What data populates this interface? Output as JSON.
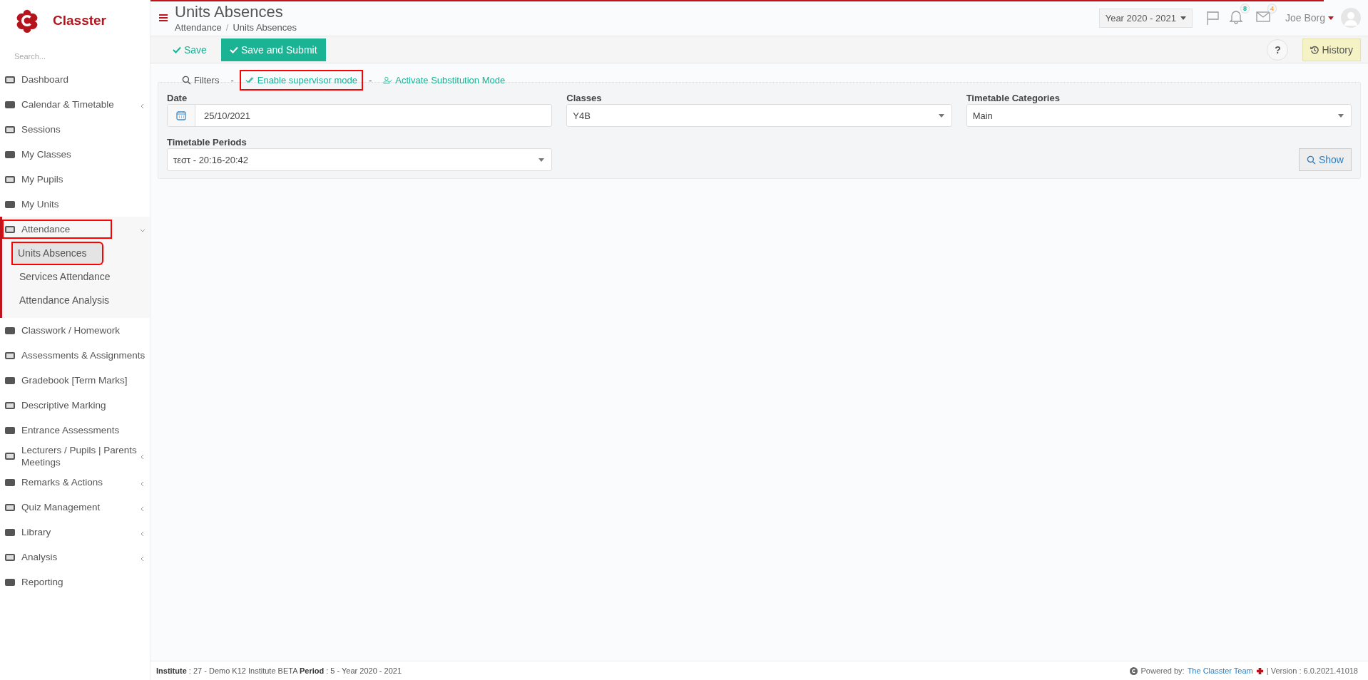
{
  "sidebar": {
    "logo": "Classter",
    "search": {
      "placeholder": "Search..."
    },
    "items": [
      {
        "label": "Dashboard",
        "submenu": false,
        "expanded": false,
        "highlighted": false
      },
      {
        "label": "Calendar & Timetable",
        "submenu": true,
        "expanded": false,
        "highlighted": false
      },
      {
        "label": "Sessions",
        "submenu": false,
        "expanded": false,
        "highlighted": false
      },
      {
        "label": "My Classes",
        "submenu": false,
        "expanded": false,
        "highlighted": false
      },
      {
        "label": "My Pupils",
        "submenu": false,
        "expanded": false,
        "highlighted": false
      },
      {
        "label": "My Units",
        "submenu": false,
        "expanded": false,
        "highlighted": false
      },
      {
        "label": "Attendance",
        "submenu": true,
        "expanded": true,
        "highlighted": true,
        "children": [
          {
            "label": "Units Absences",
            "selected": true,
            "highlighted": true
          },
          {
            "label": "Services Attendance",
            "selected": false,
            "highlighted": false
          },
          {
            "label": "Attendance Analysis",
            "selected": false,
            "highlighted": false
          }
        ]
      },
      {
        "label": "Classwork / Homework",
        "submenu": false,
        "expanded": false,
        "highlighted": false
      },
      {
        "label": "Assessments & Assignments",
        "submenu": true,
        "expanded": false,
        "highlighted": false
      },
      {
        "label": "Gradebook [Term Marks]",
        "submenu": false,
        "expanded": false,
        "highlighted": false
      },
      {
        "label": "Descriptive Marking",
        "submenu": false,
        "expanded": false,
        "highlighted": false
      },
      {
        "label": "Entrance Assessments",
        "submenu": false,
        "expanded": false,
        "highlighted": false
      },
      {
        "label": "Lecturers / Pupils | Parents Meetings",
        "submenu": true,
        "expanded": false,
        "highlighted": false
      },
      {
        "label": "Remarks & Actions",
        "submenu": true,
        "expanded": false,
        "highlighted": false
      },
      {
        "label": "Quiz Management",
        "submenu": true,
        "expanded": false,
        "highlighted": false
      },
      {
        "label": "Library",
        "submenu": true,
        "expanded": false,
        "highlighted": false
      },
      {
        "label": "Analysis",
        "submenu": true,
        "expanded": false,
        "highlighted": false
      },
      {
        "label": "Reporting",
        "submenu": false,
        "expanded": false,
        "highlighted": false
      }
    ]
  },
  "header": {
    "title": "Units Absences",
    "breadcrumb": [
      "Attendance",
      "Units Absences"
    ],
    "breadcrumb_separator": "/",
    "year": "Year 2020 - 2021",
    "notifications": [
      {
        "kind": "bell",
        "count": "8",
        "color": "#1ab394"
      },
      {
        "kind": "mail",
        "count": "4",
        "color": "#f8ac59"
      }
    ],
    "user": "Joe Borg"
  },
  "toolbar": {
    "save": "Save",
    "submit": "Save and Submit",
    "help": "?",
    "history": "History"
  },
  "filters": {
    "links": [
      {
        "kind": "filters",
        "label": "Filters",
        "highlighted": false
      },
      {
        "kind": "sep",
        "label": "-"
      },
      {
        "kind": "supervisor",
        "label": "Enable supervisor mode",
        "highlighted": true
      },
      {
        "kind": "sep",
        "label": "-"
      },
      {
        "kind": "substitution",
        "label": "Activate Substitution Mode",
        "highlighted": false
      }
    ],
    "fields": [
      {
        "kind": "date",
        "label": "Date",
        "value": "25/10/2021"
      },
      {
        "kind": "select",
        "label": "Classes",
        "value": "Y4B"
      },
      {
        "kind": "select",
        "label": "Timetable Categories",
        "value": "Main"
      },
      {
        "kind": "select",
        "label": "Timetable Periods",
        "value": "τεστ - 20:16-20:42"
      }
    ],
    "show": "Show"
  },
  "footer": {
    "info": "**Institute** : 27 - Demo K12 Institute BETA **Period** : 5 - Year 2020 - 2021",
    "powered": "Powered by:",
    "team": "The Classter Team",
    "version": "| Version : 6.0.2021.41018"
  }
}
